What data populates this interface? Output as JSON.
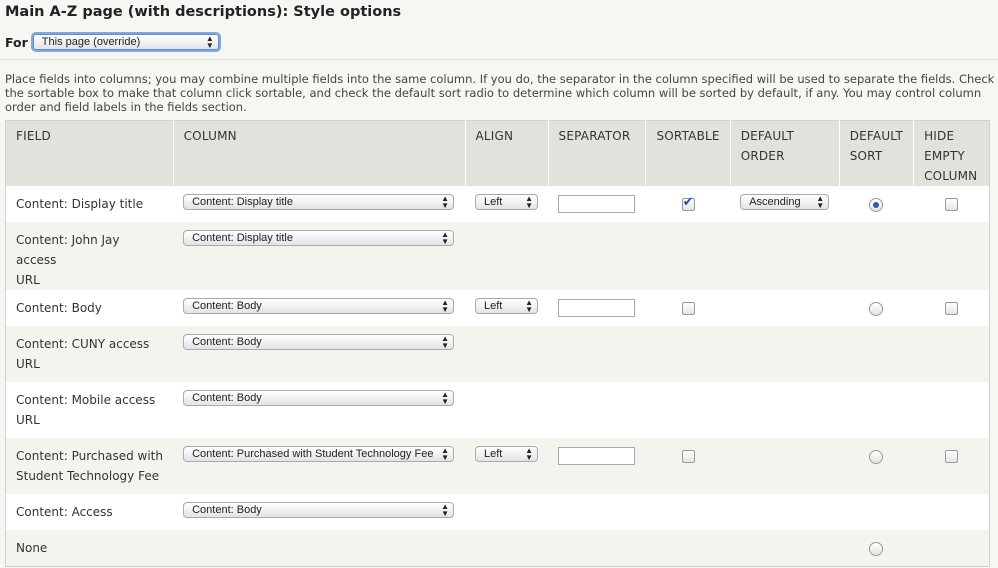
{
  "title": "Main A-Z page (with descriptions): Style options",
  "for_label": "For",
  "for_select": "This page (override)",
  "description": "Place fields into columns; you may combine multiple fields into the same column. If you do, the separator in the column specified will be used to separate the fields. Check the sortable box to make that column click sortable, and check the default sort radio to determine which column will be sorted by default, if any. You may control column order and field labels in the fields section.",
  "headers": {
    "field": "FIELD",
    "column": "COLUMN",
    "align": "ALIGN",
    "separator": "SEPARATOR",
    "sortable": "SORTABLE",
    "default_order_1": "DEFAULT",
    "default_order_2": "ORDER",
    "default_sort_1": "DEFAULT",
    "default_sort_2": "SORT",
    "hide_1": "HIDE",
    "hide_2": "EMPTY",
    "hide_3": "COLUMN"
  },
  "rows": [
    {
      "field_1": "Content: Display title",
      "field_2": "",
      "column": "Content: Display title",
      "align": "Left",
      "separator": "",
      "sortable": true,
      "default_order": "Ascending",
      "default_sort": true,
      "hide_empty": false
    },
    {
      "field_1": "Content: John Jay access",
      "field_2": "URL",
      "column": "Content: Display title"
    },
    {
      "field_1": "Content: Body",
      "field_2": "",
      "column": "Content: Body",
      "align": "Left",
      "separator": "",
      "sortable": false,
      "default_sort": false,
      "hide_empty": false
    },
    {
      "field_1": "Content: CUNY access",
      "field_2": "URL",
      "column": "Content: Body"
    },
    {
      "field_1": "Content: Mobile access",
      "field_2": "URL",
      "column": "Content: Body"
    },
    {
      "field_1": "Content: Purchased with",
      "field_2": "Student Technology Fee",
      "column": "Content: Purchased with Student Technology Fee",
      "align": "Left",
      "separator": "",
      "sortable": false,
      "default_sort": false,
      "hide_empty": false
    },
    {
      "field_1": "Content: Access",
      "field_2": "",
      "column": "Content: Body"
    },
    {
      "field_1": "None",
      "field_2": "",
      "default_sort": false
    }
  ]
}
